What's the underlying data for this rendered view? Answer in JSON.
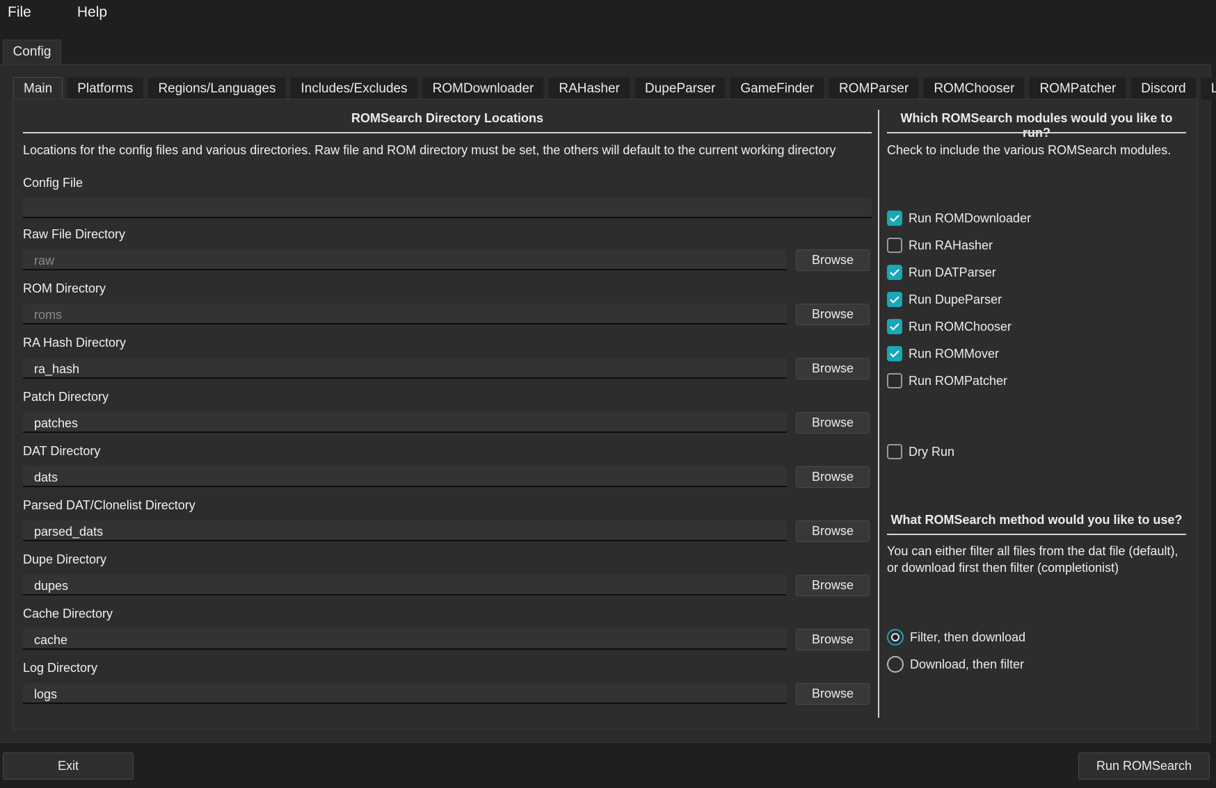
{
  "menu": [
    "File",
    "Help"
  ],
  "outer_tab": "Config",
  "tabs": [
    "Main",
    "Platforms",
    "Regions/Languages",
    "Includes/Excludes",
    "ROMDownloader",
    "RAHasher",
    "DupeParser",
    "GameFinder",
    "ROMParser",
    "ROMChooser",
    "ROMPatcher",
    "Discord",
    "Logger"
  ],
  "left": {
    "title": "ROMSearch Directory Locations",
    "description": "Locations for the config files and various directories. Raw file and ROM directory must be set, the others will default to the current working directory",
    "config_file_label": "Config File",
    "config_file_value": "",
    "browse_label": "Browse",
    "dirs": [
      {
        "label": "Raw File Directory",
        "value": "raw",
        "placeholder": true
      },
      {
        "label": "ROM Directory",
        "value": "roms",
        "placeholder": true
      },
      {
        "label": "RA Hash Directory",
        "value": "ra_hash",
        "placeholder": false
      },
      {
        "label": "Patch Directory",
        "value": "patches",
        "placeholder": false
      },
      {
        "label": "DAT Directory",
        "value": "dats",
        "placeholder": false
      },
      {
        "label": "Parsed DAT/Clonelist Directory",
        "value": "parsed_dats",
        "placeholder": false
      },
      {
        "label": "Dupe Directory",
        "value": "dupes",
        "placeholder": false
      },
      {
        "label": "Cache Directory",
        "value": "cache",
        "placeholder": false
      },
      {
        "label": "Log Directory",
        "value": "logs",
        "placeholder": false
      }
    ]
  },
  "right": {
    "modules_title": "Which ROMSearch modules would you like to run?",
    "modules_description": "Check to include the various ROMSearch modules.",
    "modules": [
      {
        "label": "Run ROMDownloader",
        "checked": true
      },
      {
        "label": "Run RAHasher",
        "checked": false
      },
      {
        "label": "Run DATParser",
        "checked": true
      },
      {
        "label": "Run DupeParser",
        "checked": true
      },
      {
        "label": "Run ROMChooser",
        "checked": true
      },
      {
        "label": "Run ROMMover",
        "checked": true
      },
      {
        "label": "Run ROMPatcher",
        "checked": false
      }
    ],
    "dry_run": {
      "label": "Dry Run",
      "checked": false
    },
    "method_title": "What ROMSearch method would you like to use?",
    "method_description_1": "You can either filter all files from the dat file (default),",
    "method_description_2": "or download first then filter (completionist)",
    "methods": [
      {
        "label": "Filter, then download",
        "selected": true
      },
      {
        "label": "Download, then filter",
        "selected": false
      }
    ]
  },
  "footer": {
    "exit_label": "Exit",
    "run_label": "Run ROMSearch"
  },
  "colors": {
    "accent": "#1aa7b8",
    "background": "#1f1f1f",
    "panel": "#2d2d2d"
  }
}
